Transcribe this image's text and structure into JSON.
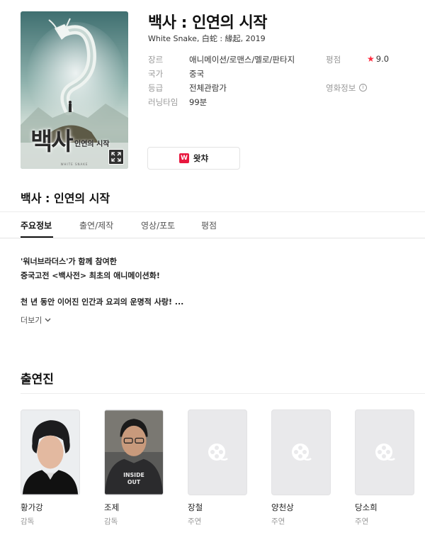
{
  "poster": {
    "title_art": "백사",
    "subtitle_art": "인연의 시작",
    "credit_art": "WHITE SNAKE"
  },
  "movie": {
    "title": "백사 : 인연의 시작",
    "subtitle": "White Snake, 白蛇 : 緣起, 2019"
  },
  "info": {
    "genre_label": "장르",
    "genre_value": "애니메이션/로맨스/멜로/판타지",
    "country_label": "국가",
    "country_value": "중국",
    "grade_label": "등급",
    "grade_value": "전체관람가",
    "runtime_label": "러닝타임",
    "runtime_value": "99분",
    "rating_label": "평점",
    "rating_value": "9.0",
    "movie_info_label": "영화정보",
    "info_icon": "i"
  },
  "watcha": {
    "logo": "W",
    "label": "왓챠"
  },
  "section": {
    "title": "백사 : 인연의 시작"
  },
  "tabs": [
    {
      "label": "주요정보"
    },
    {
      "label": "출연/제작"
    },
    {
      "label": "영상/포토"
    },
    {
      "label": "평점"
    }
  ],
  "description": {
    "line1": "'워너브라더스'가 함께 참여한",
    "line2": "중국고전 <백사전> 최초의 애니메이션화!",
    "line3": "천 년 동안 이어진 인간과 요괴의 운명적 사랑! ...",
    "more_label": "더보기"
  },
  "cast": {
    "title": "출연진",
    "members": [
      {
        "name": "황가강",
        "role": "감독"
      },
      {
        "name": "조제",
        "role": "감독"
      },
      {
        "name": "장철",
        "role": "주연"
      },
      {
        "name": "양천상",
        "role": "주연"
      },
      {
        "name": "당소희",
        "role": "주연"
      }
    ]
  },
  "colors": {
    "star": "#ff2b3e",
    "watcha_brand": "#e8173e",
    "placeholder_bg": "#e9e9eb"
  },
  "icons": {
    "star": "star-icon",
    "expand": "expand-icon",
    "chevron": "chevron-down-icon",
    "film_reel": "film-reel-icon"
  }
}
